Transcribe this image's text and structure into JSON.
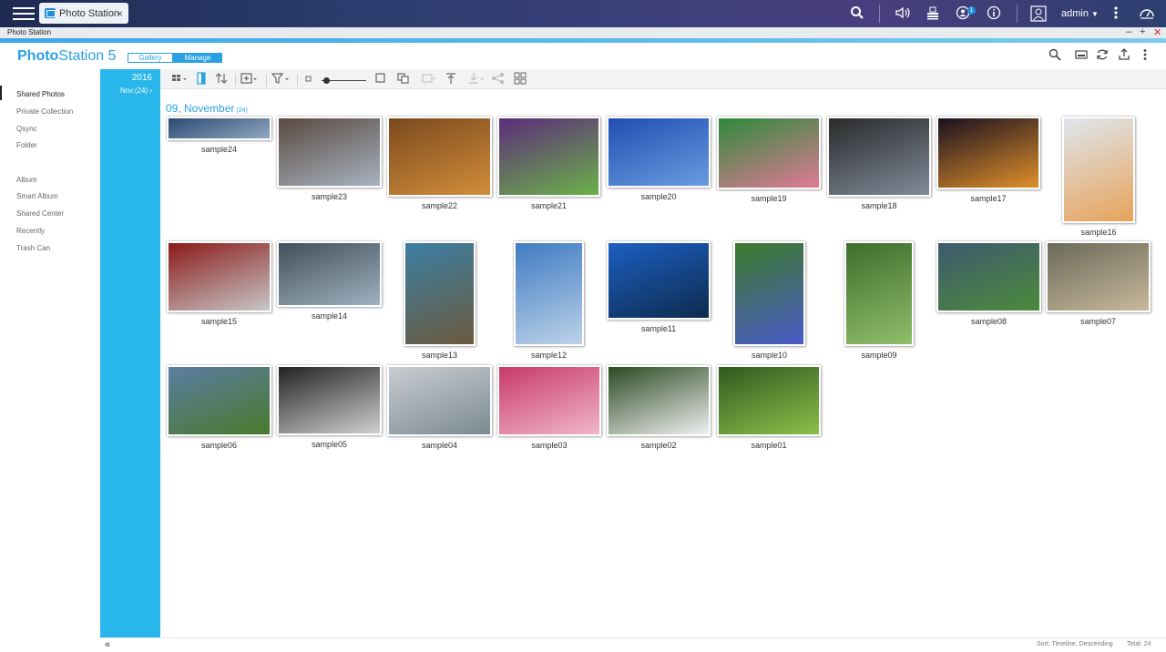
{
  "window": {
    "tab_title": "Photo Station",
    "title_bar": "Photo Station",
    "user": "admin",
    "notification_count": "1"
  },
  "app": {
    "logo_bold": "Photo",
    "logo_rest": "Station 5",
    "mode_gallery": "Gallery",
    "mode_manage": "Manage"
  },
  "sidebar": {
    "items": [
      {
        "label": "Shared Photos"
      },
      {
        "label": "Private Collection"
      },
      {
        "label": "Qsync"
      },
      {
        "label": "Folder"
      },
      {
        "label": "Album"
      },
      {
        "label": "Smart Album"
      },
      {
        "label": "Shared Center"
      },
      {
        "label": "Recently"
      },
      {
        "label": "Trash Can"
      }
    ]
  },
  "timeline": {
    "year": "2016",
    "month": "Nov.(24) ›"
  },
  "gallery": {
    "date_heading": "09, November",
    "date_count": "(24)",
    "photos": [
      {
        "name": "sample24"
      },
      {
        "name": "sample23"
      },
      {
        "name": "sample22"
      },
      {
        "name": "sample21"
      },
      {
        "name": "sample20"
      },
      {
        "name": "sample19"
      },
      {
        "name": "sample18"
      },
      {
        "name": "sample17"
      },
      {
        "name": "sample16"
      },
      {
        "name": "sample15"
      },
      {
        "name": "sample14"
      },
      {
        "name": "sample13"
      },
      {
        "name": "sample12"
      },
      {
        "name": "sample11"
      },
      {
        "name": "sample10"
      },
      {
        "name": "sample09"
      },
      {
        "name": "sample08"
      },
      {
        "name": "sample07"
      },
      {
        "name": "sample06"
      },
      {
        "name": "sample05"
      },
      {
        "name": "sample04"
      },
      {
        "name": "sample03"
      },
      {
        "name": "sample02"
      },
      {
        "name": "sample01"
      }
    ]
  },
  "footer": {
    "collapse": "«",
    "sort": "Sort: Timeline, Descending",
    "total": "Total: 24"
  },
  "colors": {
    "accent": "#29a1e2",
    "timeline": "#29b6ea"
  }
}
